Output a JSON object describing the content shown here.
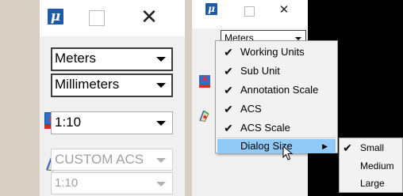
{
  "left": {
    "logo": "μ",
    "units": {
      "master": "Meters",
      "sub": "Millimeters",
      "annotation_scale": "1:10",
      "acs": "CUSTOM ACS",
      "acs_scale": "1:10"
    }
  },
  "right": {
    "logo": "μ",
    "units": {
      "master": "Meters"
    },
    "context_menu": {
      "items": [
        {
          "label": "Working Units",
          "checked": true
        },
        {
          "label": "Sub Unit",
          "checked": true
        },
        {
          "label": "Annotation Scale",
          "checked": true
        },
        {
          "label": "ACS",
          "checked": true
        },
        {
          "label": "ACS Scale",
          "checked": true
        }
      ],
      "dialog_size_label": "Dialog Size"
    },
    "dialog_size_submenu": {
      "items": [
        {
          "label": "Small",
          "checked": true
        },
        {
          "label": "Medium",
          "checked": false
        },
        {
          "label": "Large",
          "checked": false
        }
      ]
    }
  },
  "colors": {
    "accent": "#1e5aa8",
    "menu_highlight": "#91c9f7",
    "annotation_icon": "#d62b2b"
  }
}
